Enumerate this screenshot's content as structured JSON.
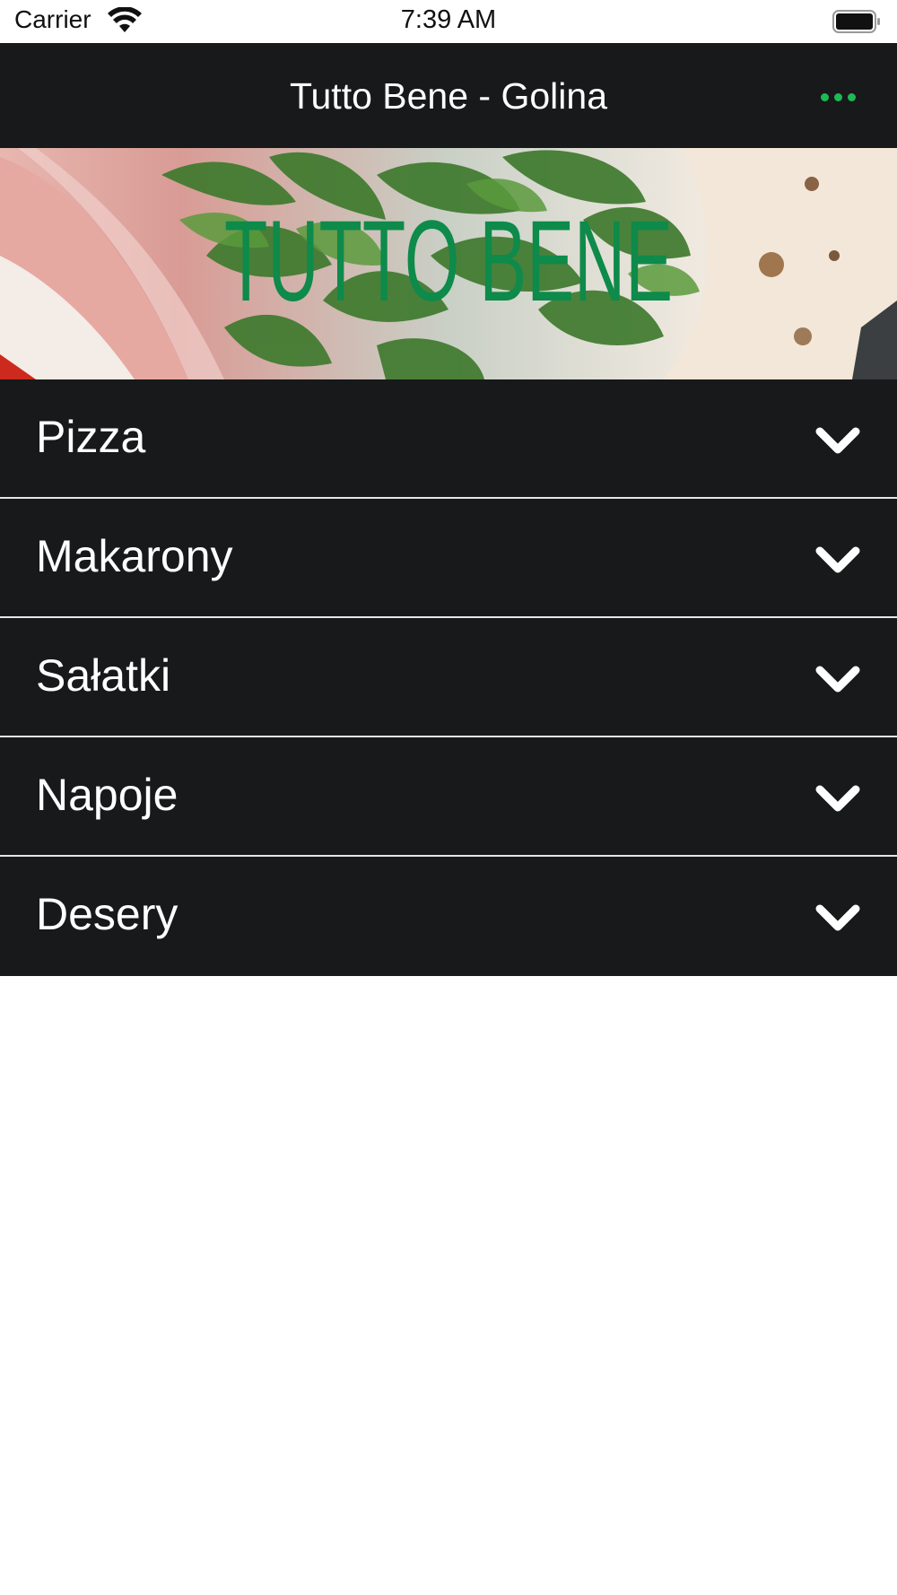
{
  "status_bar": {
    "carrier": "Carrier",
    "time": "7:39 AM",
    "wifi_icon": "wifi-icon",
    "battery_icon": "battery-icon"
  },
  "header": {
    "title": "Tutto Bene - Golina",
    "more_icon": "more-dots-icon",
    "accent_color": "#1db954",
    "background_color": "#18191a"
  },
  "hero": {
    "logo_text": "TUTTO BENE",
    "logo_color": "#0e8a4a"
  },
  "categories": [
    {
      "label": "Pizza",
      "icon": "chevron-down-icon"
    },
    {
      "label": "Makarony",
      "icon": "chevron-down-icon"
    },
    {
      "label": "Sałatki",
      "icon": "chevron-down-icon"
    },
    {
      "label": "Napoje",
      "icon": "chevron-down-icon"
    },
    {
      "label": "Desery",
      "icon": "chevron-down-icon"
    }
  ]
}
